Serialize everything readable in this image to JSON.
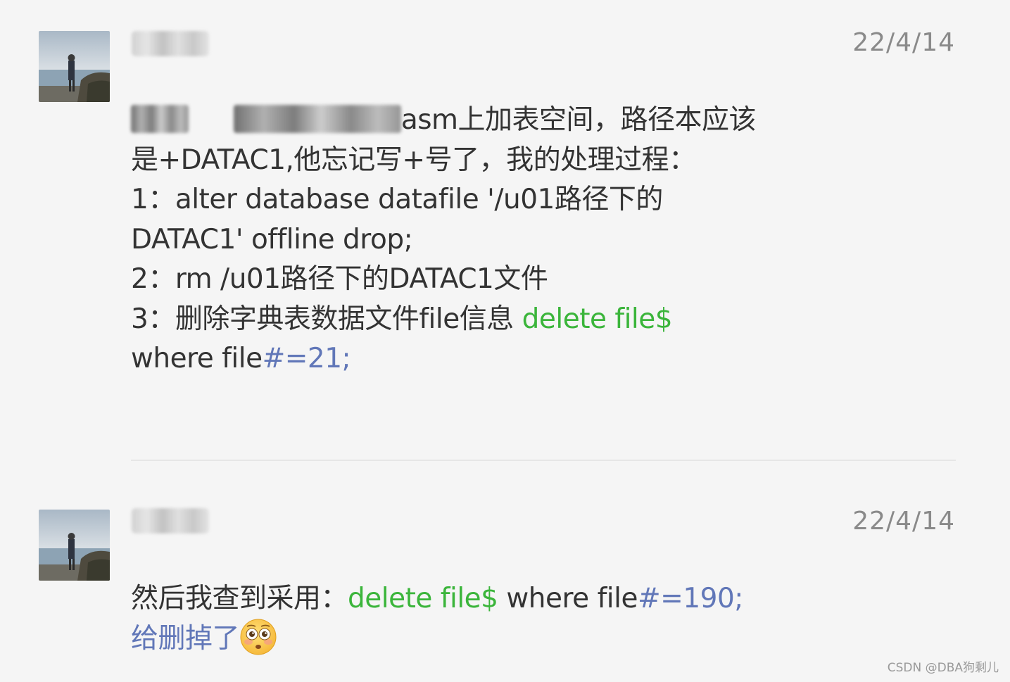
{
  "messages": [
    {
      "date": "22/4/14",
      "lines": {
        "l1_tail": "asm上加表空间，路径本应该",
        "l2": "是+DATAC1,他忘记写+号了，我的处理过程：",
        "l3": "1：alter database datafile '/u01路径下的",
        "l4": "DATAC1' offline drop;",
        "l5": "2：rm /u01路径下的DATAC1文件",
        "l6_text": "3：删除字典表数据文件file信息 ",
        "l6_code": "delete file$",
        "l7_text": "where file",
        "l7_code": "#=21;"
      }
    },
    {
      "date": "22/4/14",
      "lines": {
        "l1_text": "然后我查到采用：",
        "l1_code": "delete file$",
        "l1_mid": " where file",
        "l1_tail": "#=190;",
        "l2_text": "给删掉了"
      }
    }
  ],
  "watermark": "CSDN @DBA狗剩儿",
  "colors": {
    "code_green": "#3bb53b",
    "code_blue": "#6177b8",
    "text": "#333333",
    "date": "#8a8a8a"
  },
  "icons": {
    "avatar": "person-by-sea-avatar",
    "emoji": "flushed-face-emoji"
  }
}
